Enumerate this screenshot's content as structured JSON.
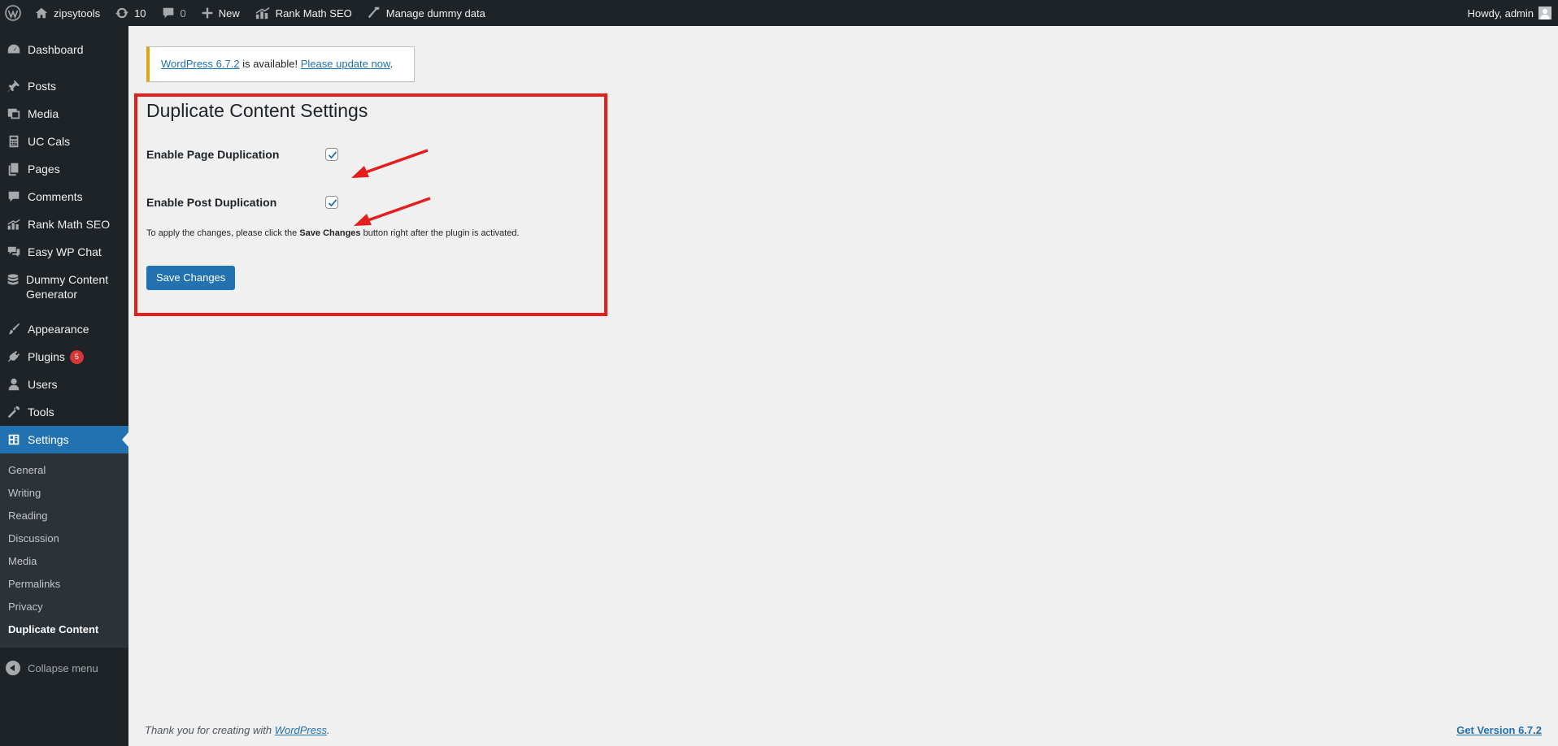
{
  "admin_bar": {
    "site_name": "zipsytools",
    "updates_count": "10",
    "comments_count": "0",
    "new_label": "New",
    "rank_math_label": "Rank Math SEO",
    "manage_dummy_label": "Manage dummy data",
    "greeting": "Howdy, admin"
  },
  "sidebar": {
    "items": [
      {
        "label": "Dashboard",
        "icon": "dashboard-icon"
      },
      {
        "label": "Posts",
        "icon": "pin-icon"
      },
      {
        "label": "Media",
        "icon": "media-icon"
      },
      {
        "label": "UC Cals",
        "icon": "calculator-icon"
      },
      {
        "label": "Pages",
        "icon": "pages-icon"
      },
      {
        "label": "Comments",
        "icon": "comment-icon"
      },
      {
        "label": "Rank Math SEO",
        "icon": "chart-icon"
      },
      {
        "label": "Easy WP Chat",
        "icon": "chat-icon"
      },
      {
        "label": "Dummy Content Generator",
        "icon": "database-icon"
      },
      {
        "label": "Appearance",
        "icon": "brush-icon"
      },
      {
        "label": "Plugins",
        "icon": "plug-icon",
        "badge": "5"
      },
      {
        "label": "Users",
        "icon": "user-icon"
      },
      {
        "label": "Tools",
        "icon": "wrench-icon"
      },
      {
        "label": "Settings",
        "icon": "settings-icon"
      }
    ],
    "submenu": [
      "General",
      "Writing",
      "Reading",
      "Discussion",
      "Media",
      "Permalinks",
      "Privacy",
      "Duplicate Content"
    ],
    "collapse_label": "Collapse menu"
  },
  "notice": {
    "version_link": "WordPress 6.7.2",
    "middle_text": " is available! ",
    "update_link": "Please update now",
    "end_text": "."
  },
  "main": {
    "title": "Duplicate Content Settings",
    "page_duplication_label": "Enable Page Duplication",
    "page_duplication_checked": true,
    "post_duplication_label": "Enable Post Duplication",
    "post_duplication_checked": true,
    "note_before": "To apply the changes, please click the ",
    "note_bold": "Save Changes",
    "note_after": " button right after the plugin is activated.",
    "save_button": "Save Changes"
  },
  "footer": {
    "thanks_before": "Thank you for creating with ",
    "thanks_link": "WordPress",
    "thanks_after": ".",
    "version_link": "Get Version 6.7.2"
  },
  "colors": {
    "admin_dark": "#1d2327",
    "accent_blue": "#2271b1",
    "notice_yellow": "#dba617",
    "highlight_red": "#e41d1d"
  }
}
